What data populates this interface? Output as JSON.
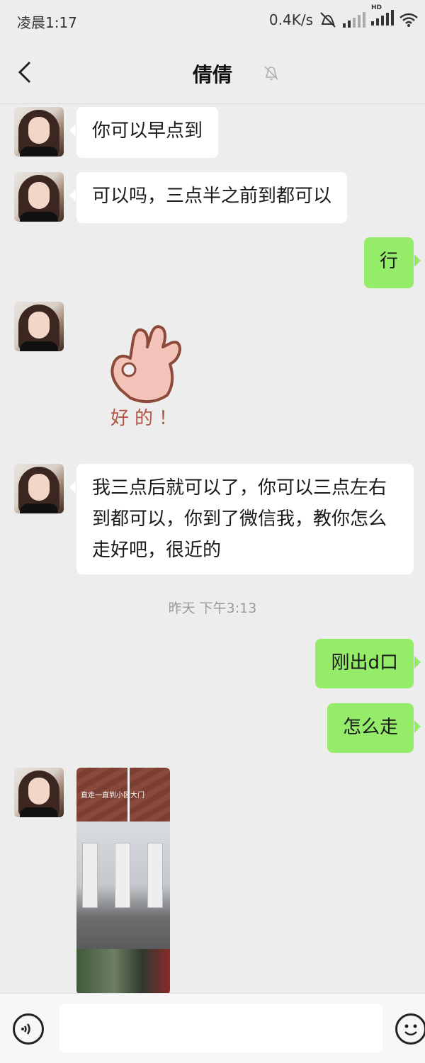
{
  "status_bar": {
    "time": "凌晨1:17",
    "net_speed": "0.4K/s",
    "hd_label": "HD",
    "icons": [
      "mute-alarm-icon",
      "signal-icon",
      "signal-hd-icon",
      "wifi-icon"
    ]
  },
  "header": {
    "title": "倩倩",
    "back_icon": "chevron-left-icon",
    "mute_icon": "bell-off-icon"
  },
  "messages": [
    {
      "side": "left",
      "type": "text",
      "text": "你可以早点到"
    },
    {
      "side": "left",
      "type": "text",
      "text": "可以吗，三点半之前到都可以"
    },
    {
      "side": "right",
      "type": "text",
      "text": "行"
    },
    {
      "side": "left",
      "type": "sticker",
      "text": "好的！"
    },
    {
      "side": "left",
      "type": "text",
      "text": "我三点后就可以了，你可以三点左右到都可以，你到了微信我，教你怎么走好吧，很近的"
    },
    {
      "type": "timestamp",
      "text": "昨天 下午3:13"
    },
    {
      "side": "right",
      "type": "text",
      "text": "刚出d口"
    },
    {
      "side": "right",
      "type": "text",
      "text": "怎么走"
    },
    {
      "side": "left",
      "type": "image",
      "caption": "直走一直到小区大门"
    }
  ],
  "input_bar": {
    "voice_icon": "voice-icon",
    "emoji_icon": "emoji-icon",
    "placeholder": ""
  },
  "colors": {
    "background": "#ededed",
    "bubble_self": "#95ec69",
    "bubble_other": "#ffffff"
  }
}
